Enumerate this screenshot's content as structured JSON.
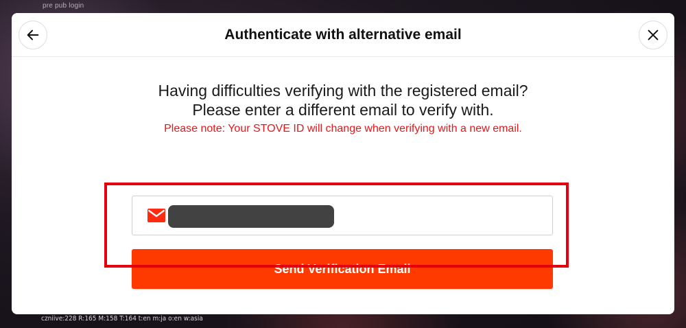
{
  "background": {
    "tag_text": "pre pub login",
    "debug_text": "czniive:228 R:165 M:158 T:164 t:en m:ja o:en w:asia"
  },
  "modal": {
    "title": "Authenticate with alternative email",
    "back_icon": "arrow-left-icon",
    "close_icon": "close-icon",
    "lead_line1": "Having difficulties verifying with the registered email?",
    "lead_line2": "Please enter a different email to verify with.",
    "note": "Please note: Your STOVE ID will change when verifying with a new email.",
    "email_field": {
      "icon": "mail-icon",
      "value": "",
      "redacted": true
    },
    "send_button_label": "Send Verification Email"
  },
  "colors": {
    "accent": "#ff3a00",
    "warning_text": "#e8161b",
    "highlight_border": "#e5000f"
  }
}
